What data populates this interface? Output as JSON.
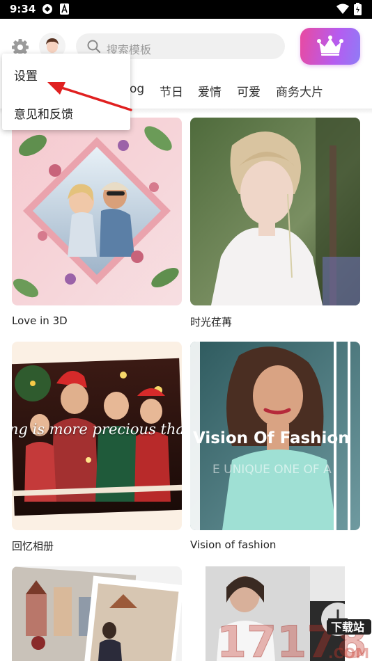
{
  "status_bar": {
    "time": "9:34",
    "icons": [
      "vpn-icon",
      "a-badge-icon",
      "wifi-icon",
      "battery-icon"
    ]
  },
  "header": {
    "settings_icon": "gear-icon",
    "avatar_icon": "avatar",
    "search": {
      "placeholder": "搜索模板",
      "icon": "search-icon"
    },
    "vip_icon": "crown-icon",
    "vip_gradient": [
      "#e94aa0",
      "#b55cf0",
      "#8f7cf6"
    ]
  },
  "tabs": {
    "items": [
      {
        "label": "og"
      },
      {
        "label": "节日"
      },
      {
        "label": "爱情"
      },
      {
        "label": "可爱"
      },
      {
        "label": "商务大片"
      }
    ]
  },
  "menu": {
    "items": [
      {
        "label": "设置"
      },
      {
        "label": "意见和反馈"
      }
    ]
  },
  "annotation": {
    "arrow_color": "#e02020"
  },
  "templates": [
    {
      "title": "Love in 3D"
    },
    {
      "title": "时光荏苒"
    },
    {
      "title": "回忆相册",
      "overlay_text": "ng is more precious than f"
    },
    {
      "title": "Vision of  fashion",
      "overlay_text": "Vision Of Fashion",
      "overlay_subtext": "E UNIQUE ONE OF A"
    },
    {
      "title": ""
    },
    {
      "title": ""
    }
  ],
  "watermark": {
    "text": "17178",
    "suffix": ".COM",
    "badge": "下载站"
  }
}
